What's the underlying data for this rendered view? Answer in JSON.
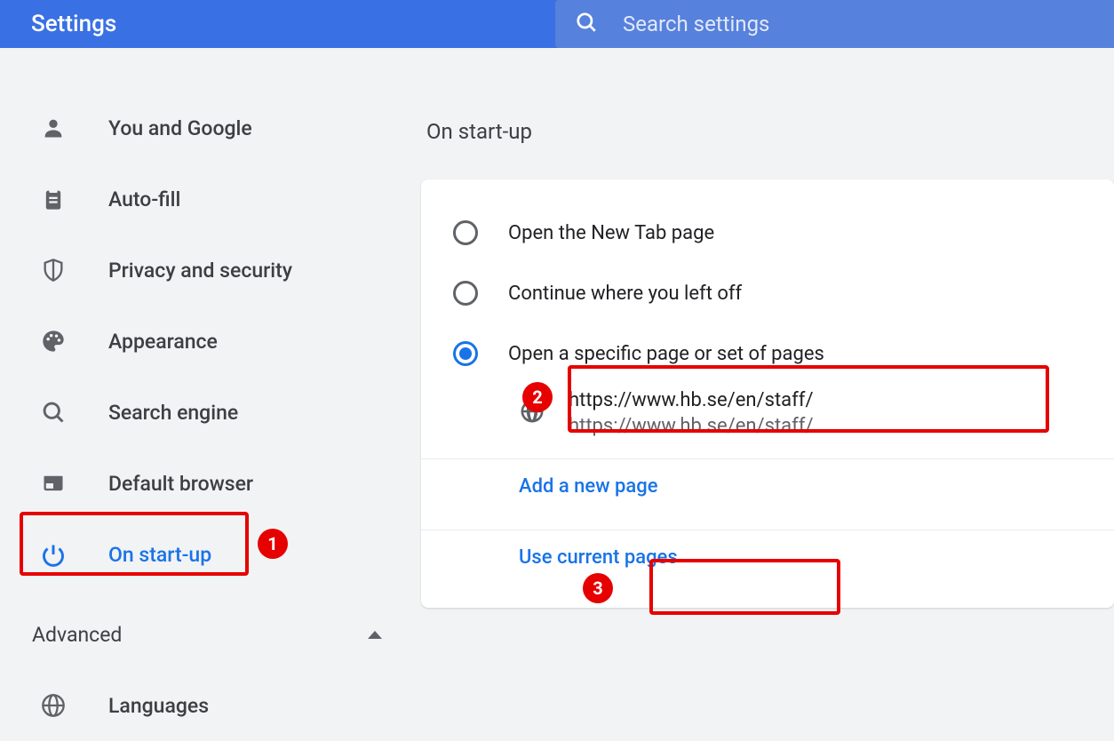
{
  "header": {
    "title": "Settings",
    "search_placeholder": "Search settings"
  },
  "sidebar": {
    "items": [
      {
        "label": "You and Google",
        "icon": "person"
      },
      {
        "label": "Auto-fill",
        "icon": "clipboard"
      },
      {
        "label": "Privacy and security",
        "icon": "shield"
      },
      {
        "label": "Appearance",
        "icon": "palette"
      },
      {
        "label": "Search engine",
        "icon": "search"
      },
      {
        "label": "Default browser",
        "icon": "browser"
      },
      {
        "label": "On start-up",
        "icon": "power",
        "active": true
      }
    ],
    "advanced_label": "Advanced",
    "advanced_items": [
      {
        "label": "Languages",
        "icon": "globe"
      }
    ]
  },
  "main": {
    "section_title": "On start-up",
    "options": [
      {
        "label": "Open the New Tab page",
        "selected": false
      },
      {
        "label": "Continue where you left off",
        "selected": false
      },
      {
        "label": "Open a specific page or set of pages",
        "selected": true
      }
    ],
    "pages": [
      {
        "title": "https://www.hb.se/en/staff/",
        "url": "https://www.hb.se/en/staff/"
      }
    ],
    "add_page_label": "Add a new page",
    "use_current_label": "Use current pages"
  },
  "annotations": {
    "callouts": [
      "1",
      "2",
      "3"
    ]
  }
}
